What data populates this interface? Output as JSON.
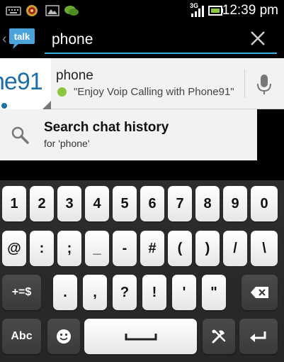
{
  "status_bar": {
    "network_label": "3G",
    "time": "12:39 pm"
  },
  "action_bar": {
    "app_logo_text": "talk",
    "search_value": "phone"
  },
  "suggestion": {
    "thumb_text": "ne91",
    "title": "phone",
    "status_message": "\"Enjoy Voip Calling with Phone91\"",
    "status_color": "#8cc63f"
  },
  "history": {
    "title": "Search chat history",
    "subtitle": "for 'phone'"
  },
  "keyboard": {
    "row1": [
      "1",
      "2",
      "3",
      "4",
      "5",
      "6",
      "7",
      "8",
      "9",
      "0"
    ],
    "row2": [
      "@",
      ":",
      ";",
      "_",
      "-",
      "#",
      "(",
      ")",
      "/",
      "\\"
    ],
    "row3_left": "+=$",
    "row3_keys": [
      ".",
      ",",
      "?",
      "!",
      "'",
      "\""
    ],
    "abc_label": "Abc"
  },
  "colors": {
    "accent": "#33b5e5",
    "thumb_blue": "#1d6fa8"
  }
}
